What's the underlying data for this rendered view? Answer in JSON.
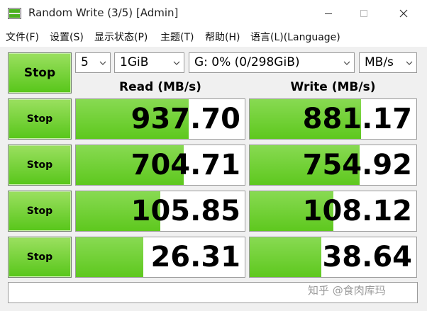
{
  "window": {
    "title": "Random Write (3/5) [Admin]"
  },
  "menu": [
    "文件(F)",
    "设置(S)",
    "显示状态(P)",
    "主题(T)",
    "帮助(H)",
    "语言(L)(Language)"
  ],
  "controls": {
    "all_button_label": "Stop",
    "count": "5",
    "size": "1GiB",
    "drive": "G: 0% (0/298GiB)",
    "unit": "MB/s"
  },
  "columns": {
    "read": "Read (MB/s)",
    "write": "Write (MB/s)"
  },
  "rows": [
    {
      "button_label": "Stop",
      "read": "937.70",
      "write": "881.17",
      "read_fill": 0.67,
      "write_fill": 0.67
    },
    {
      "button_label": "Stop",
      "read": "704.71",
      "write": "754.92",
      "read_fill": 0.64,
      "write_fill": 0.66
    },
    {
      "button_label": "Stop",
      "read": "105.85",
      "write": "108.12",
      "read_fill": 0.5,
      "write_fill": 0.5
    },
    {
      "button_label": "Stop",
      "read": "26.31",
      "write": "38.64",
      "read_fill": 0.4,
      "write_fill": 0.43
    }
  ],
  "comment": {
    "value": ""
  },
  "watermark": "知乎 @食肉库玛",
  "colors": {
    "accent_green": "#5ec81e",
    "button_green": "#8ede55",
    "border": "#9a9a9a"
  }
}
